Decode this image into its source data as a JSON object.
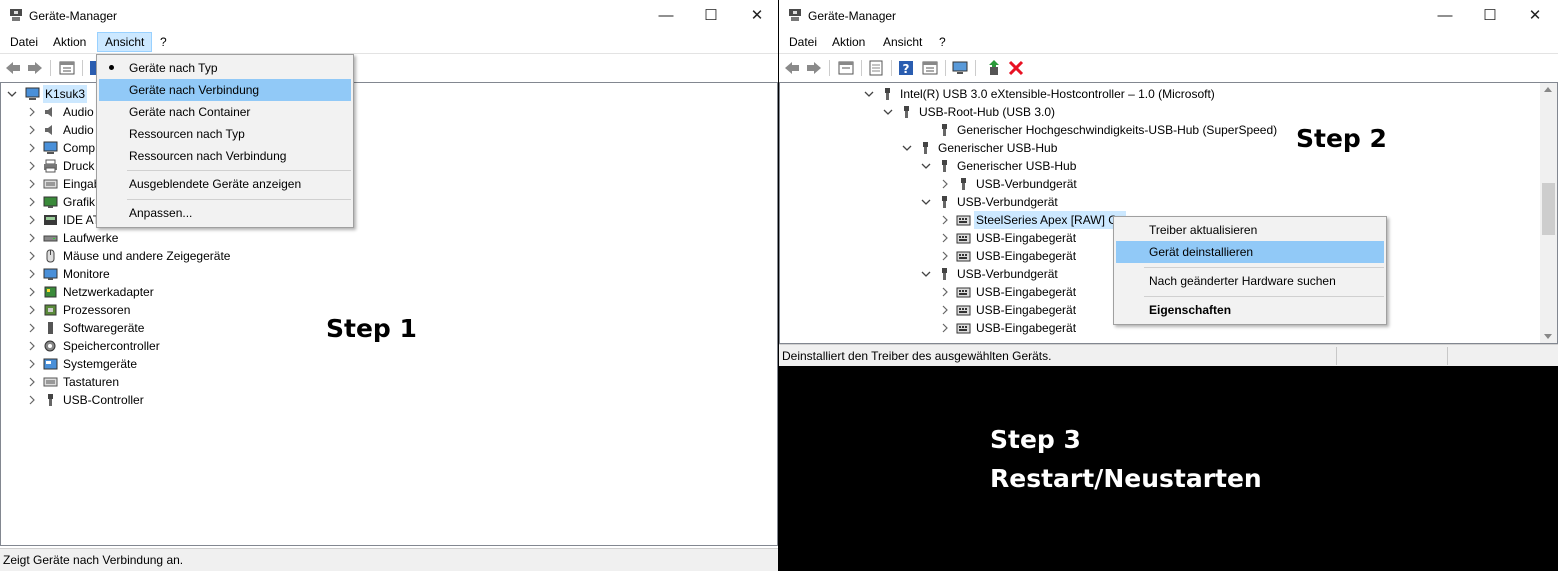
{
  "left": {
    "title": "Geräte-Manager",
    "menu": [
      "Datei",
      "Aktion",
      "Ansicht",
      "?"
    ],
    "active_menu": "Ansicht",
    "root": "K1suk3",
    "tree": [
      {
        "label": "Audio",
        "icon": "speaker-icon"
      },
      {
        "label": "Audio",
        "icon": "speaker-icon"
      },
      {
        "label": "Comp",
        "icon": "computer-icon"
      },
      {
        "label": "Druck",
        "icon": "printer-icon"
      },
      {
        "label": "Eingab",
        "icon": "keyboard-icon"
      },
      {
        "label": "Grafik",
        "icon": "display-icon"
      },
      {
        "label": "IDE AT",
        "icon": "ide-icon"
      },
      {
        "label": "Laufwerke",
        "icon": "disk-icon"
      },
      {
        "label": "Mäuse und andere Zeigegeräte",
        "icon": "mouse-icon"
      },
      {
        "label": "Monitore",
        "icon": "monitor-icon"
      },
      {
        "label": "Netzwerkadapter",
        "icon": "network-icon"
      },
      {
        "label": "Prozessoren",
        "icon": "cpu-icon"
      },
      {
        "label": "Softwaregeräte",
        "icon": "software-device-icon"
      },
      {
        "label": "Speichercontroller",
        "icon": "storage-controller-icon"
      },
      {
        "label": "Systemgeräte",
        "icon": "system-device-icon"
      },
      {
        "label": "Tastaturen",
        "icon": "keyboard-icon"
      },
      {
        "label": "USB-Controller",
        "icon": "usb-icon"
      }
    ],
    "ansicht_menu": {
      "items": [
        {
          "label": "Geräte nach Typ",
          "checked": true
        },
        {
          "label": "Geräte nach Verbindung",
          "highlighted": true
        },
        {
          "label": "Geräte nach Container"
        },
        {
          "label": "Ressourcen nach Typ"
        },
        {
          "label": "Ressourcen nach Verbindung"
        },
        {
          "label": "Ausgeblendete Geräte anzeigen"
        },
        {
          "label": "Anpassen..."
        }
      ]
    },
    "status": "Zeigt Geräte nach Verbindung an.",
    "step_label": "Step 1"
  },
  "right": {
    "title": "Geräte-Manager",
    "menu": [
      "Datei",
      "Aktion",
      "Ansicht",
      "?"
    ],
    "tree": [
      {
        "label": "Intel(R) USB 3.0 eXtensible-Hostcontroller – 1.0 (Microsoft)"
      },
      {
        "label": "USB-Root-Hub (USB 3.0)"
      },
      {
        "label": "Generischer Hochgeschwindigkeits-USB-Hub (SuperSpeed)"
      },
      {
        "label": "Generischer USB-Hub"
      },
      {
        "label": "Generischer USB-Hub"
      },
      {
        "label": "USB-Verbundgerät"
      },
      {
        "label": "USB-Verbundgerät"
      },
      {
        "label": "SteelSeries Apex [RAW] Ga"
      },
      {
        "label": "USB-Eingabegerät"
      },
      {
        "label": "USB-Eingabegerät"
      },
      {
        "label": "USB-Verbundgerät"
      },
      {
        "label": "USB-Eingabegerät"
      },
      {
        "label": "USB-Eingabegerät"
      },
      {
        "label": "USB-Eingabegerät"
      }
    ],
    "context_menu": {
      "items": [
        {
          "label": "Treiber aktualisieren"
        },
        {
          "label": "Gerät deinstallieren",
          "highlighted": true
        },
        {
          "label": "Nach geänderter Hardware suchen"
        },
        {
          "label": "Eigenschaften",
          "bold": true
        }
      ]
    },
    "status": "Deinstalliert den Treiber des ausgewählten Geräts.",
    "step_label": "Step 2"
  },
  "step3": {
    "line1": "Step 3",
    "line2": "Restart/Neustarten"
  },
  "colors": {
    "highlight": "#91c9f7",
    "menu_active": "#cce8ff",
    "delete_x": "#e81123",
    "window_bg": "#ffffff",
    "backdrop": "#000000"
  }
}
